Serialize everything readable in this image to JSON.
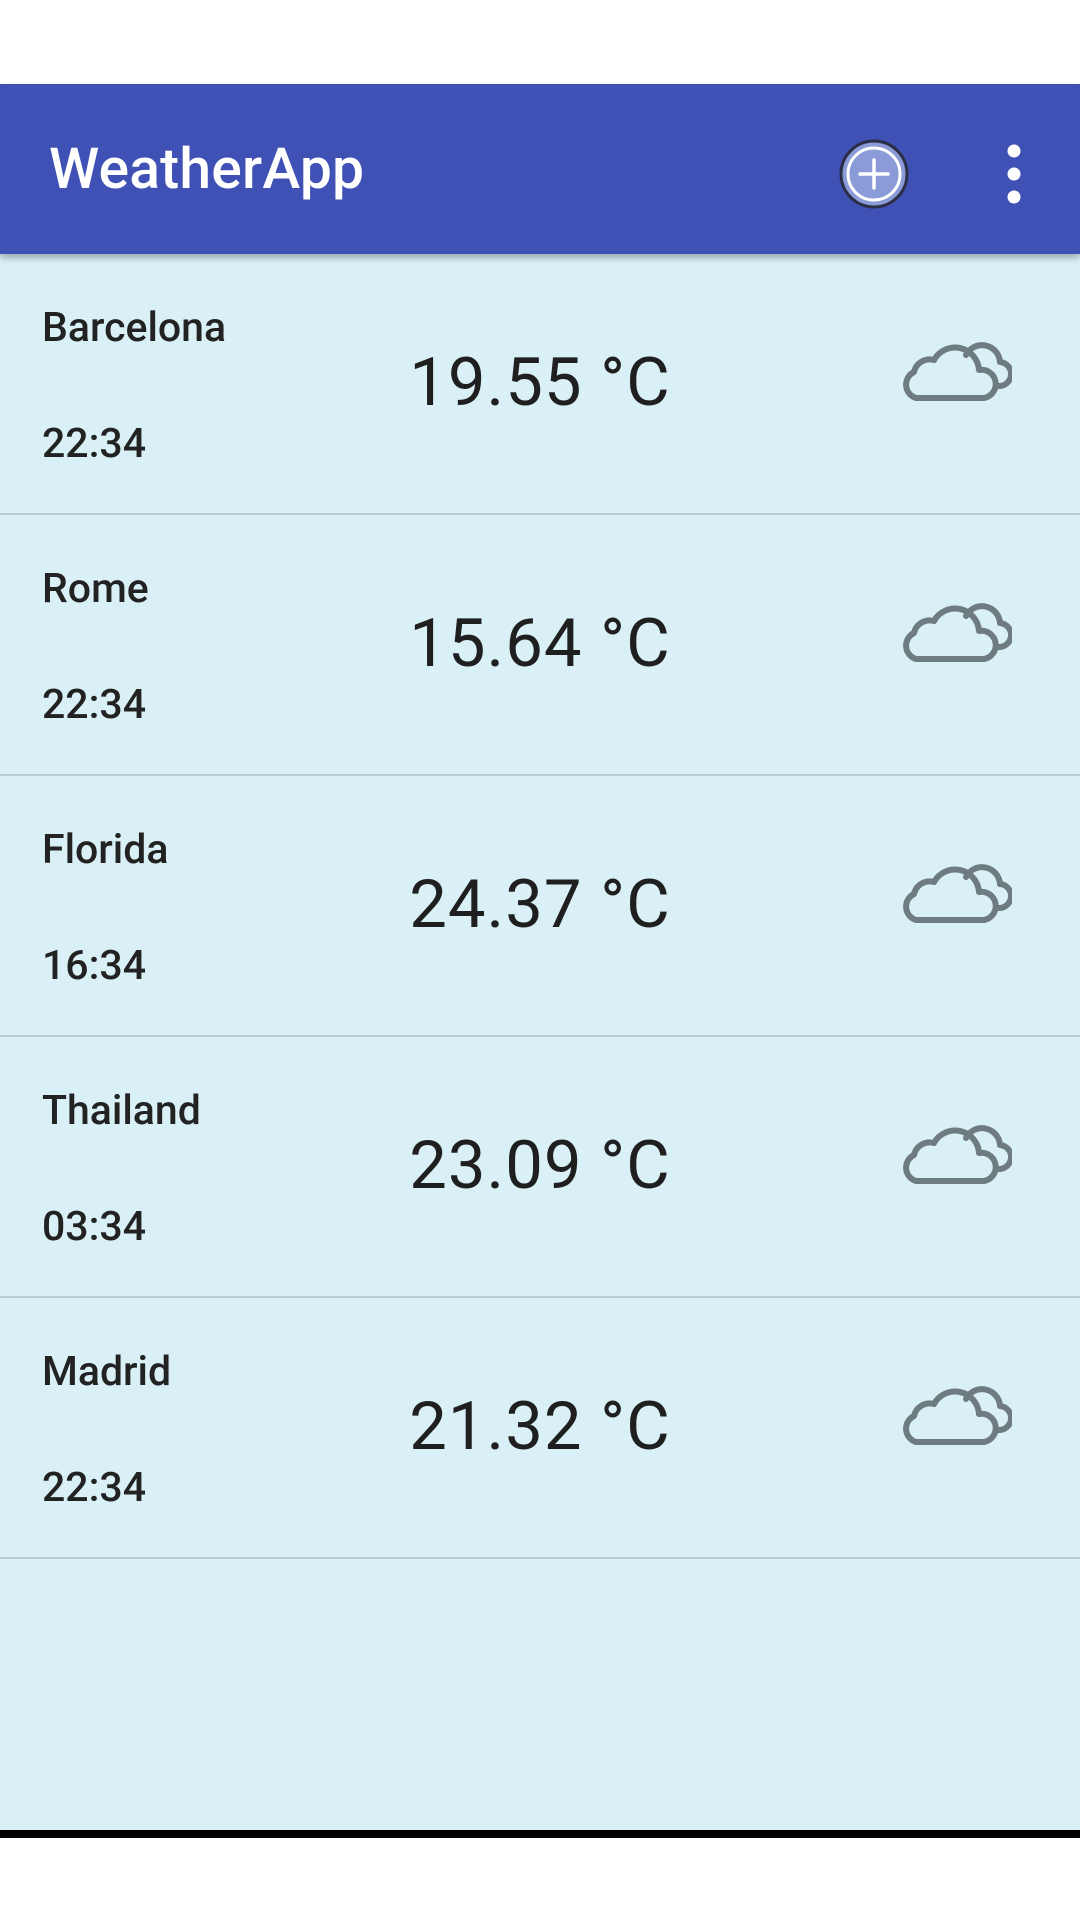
{
  "app_bar": {
    "title": "WeatherApp",
    "color": "#3f51b5",
    "actions": [
      "add-circle-icon",
      "more-vert-icon"
    ]
  },
  "cities": [
    {
      "name": "Barcelona",
      "time": "22:34",
      "temperature": "19.55 °C",
      "icon": "cloud-icon"
    },
    {
      "name": "Rome",
      "time": "22:34",
      "temperature": "15.64 °C",
      "icon": "cloud-icon"
    },
    {
      "name": "Florida",
      "time": "16:34",
      "temperature": "24.37 °C",
      "icon": "cloud-icon"
    },
    {
      "name": "Thailand",
      "time": "03:34",
      "temperature": "23.09 °C",
      "icon": "cloud-icon"
    },
    {
      "name": "Madrid",
      "time": "22:34",
      "temperature": "21.32 °C",
      "icon": "cloud-icon"
    }
  ],
  "colors": {
    "list_background": "#d9f0f6",
    "divider": "#b9cbd1",
    "icon": "#6e7b80"
  }
}
